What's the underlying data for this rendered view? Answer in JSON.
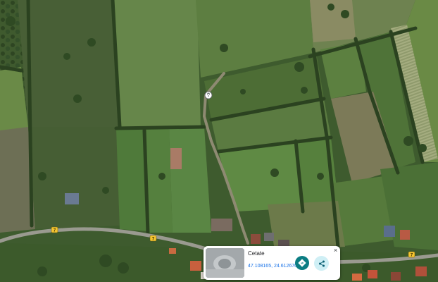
{
  "map": {
    "view": "satellite",
    "marker_icon": "location-pin-icon",
    "road_badges": [
      {
        "label": "7"
      },
      {
        "label": "7"
      },
      {
        "label": "7"
      }
    ]
  },
  "place_card": {
    "title": "Cetate",
    "coordinates": "47.108165, 24.612670",
    "thumbnail": "place-photo",
    "directions_icon": "directions-icon",
    "share_icon": "share-icon",
    "close_label": "×",
    "accent_color": "#0b7d83"
  }
}
